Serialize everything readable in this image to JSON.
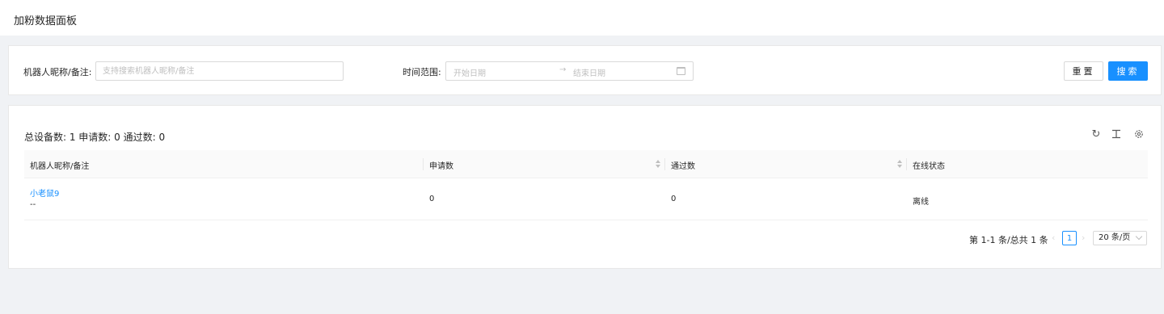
{
  "page": {
    "title": "加粉数据面板"
  },
  "search": {
    "robot_label": "机器人昵称/备注:",
    "robot_placeholder": "支持搜索机器人昵称/备注",
    "time_label": "时间范围:",
    "start_placeholder": "开始日期",
    "range_separator": "→",
    "end_placeholder": "结束日期",
    "reset_label": "重置",
    "search_label": "搜索",
    "calendar_icon": "calendar-icon"
  },
  "summary": {
    "text": "总设备数: 1 申请数: 0 通过数: 0"
  },
  "toolbar": {
    "icons": [
      "reload-icon",
      "density-icon",
      "setting-icon"
    ]
  },
  "table": {
    "columns": [
      "机器人昵称/备注",
      "申请数",
      "通过数",
      "在线状态"
    ],
    "rows": [
      {
        "name": "小老鼠9",
        "remark": "--",
        "applications": "0",
        "approved": "0",
        "status": "离线"
      }
    ]
  },
  "pagination": {
    "total_text": "第 1-1 条/总共 1 条",
    "current_page": "1",
    "page_size": "20 条/页"
  },
  "colors": {
    "accent": "#1890ff",
    "background": "#f0f2f5"
  }
}
